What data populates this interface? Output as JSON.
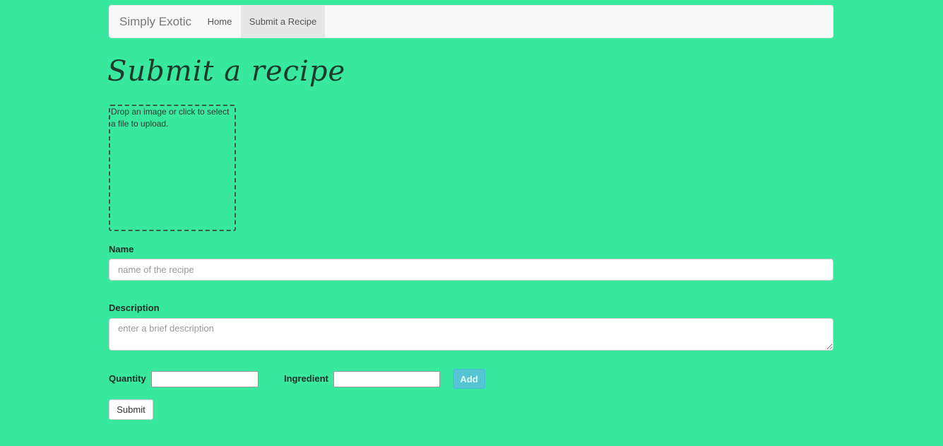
{
  "navbar": {
    "brand": "Simply Exotic",
    "items": [
      {
        "label": "Home",
        "active": false
      },
      {
        "label": "Submit a Recipe",
        "active": true
      }
    ]
  },
  "page": {
    "title": "Submit a recipe"
  },
  "dropzone": {
    "text": "Drop an image or click to select a file to upload."
  },
  "form": {
    "name": {
      "label": "Name",
      "value": "",
      "placeholder": "name of the recipe"
    },
    "description": {
      "label": "Description",
      "value": "",
      "placeholder": "enter a brief description"
    },
    "quantity": {
      "label": "Quantity",
      "value": ""
    },
    "ingredient": {
      "label": "Ingredient",
      "value": ""
    },
    "add_button": "Add",
    "submit_button": "Submit"
  },
  "colors": {
    "background": "#37e89e",
    "navbar_bg": "#f8f8f8",
    "active_tab_bg": "#e7e7e7",
    "add_button": "#5bc0de"
  }
}
